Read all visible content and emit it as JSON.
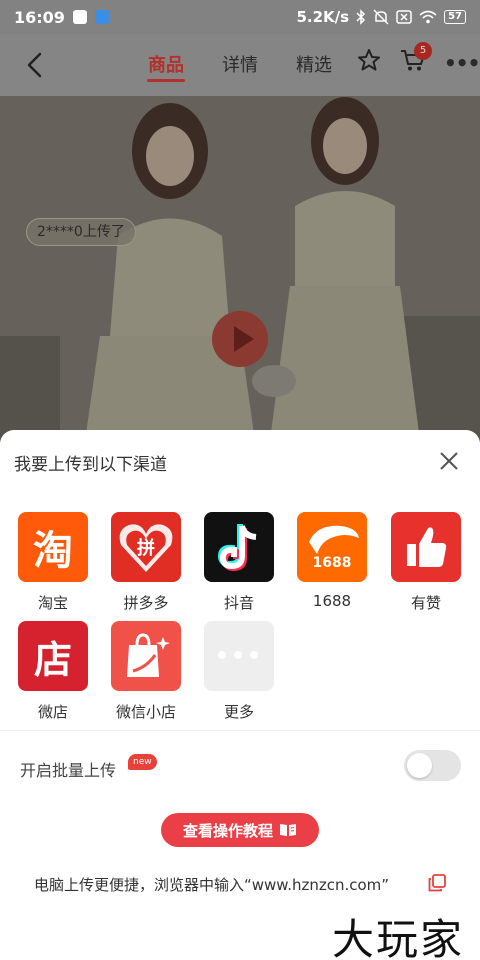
{
  "status_bar": {
    "time": "16:09",
    "network_speed": "5.2K/s",
    "battery": "57",
    "icons": [
      "bluetooth-icon",
      "mute-icon",
      "sim-off-icon",
      "wifi-icon",
      "battery-icon"
    ]
  },
  "navbar": {
    "tabs": [
      {
        "label": "商品",
        "active": true
      },
      {
        "label": "详情",
        "active": false
      },
      {
        "label": "精选",
        "active": false
      }
    ],
    "cart_count": "5",
    "more_label": "•••",
    "accent_color": "#b3312b"
  },
  "hero": {
    "upload_tag": "2****0上传了"
  },
  "sheet": {
    "title": "我要上传到以下渠道",
    "channels": [
      {
        "label": "淘宝",
        "glyph": "淘"
      },
      {
        "label": "拼多多",
        "glyph": "拼"
      },
      {
        "label": "抖音",
        "glyph": "♪"
      },
      {
        "label": "1688",
        "glyph": "1688"
      },
      {
        "label": "有赞",
        "glyph": "👍"
      },
      {
        "label": "微店",
        "glyph": "店"
      },
      {
        "label": "微信小店",
        "glyph": "🛍"
      },
      {
        "label": "更多",
        "glyph": "•••"
      }
    ],
    "batch_label": "开启批量上传",
    "new_badge": "new",
    "batch_enabled": false,
    "tutorial_button": "查看操作教程",
    "pc_tip": "电脑上传更便捷，浏览器中输入“www.hznzcn.com”",
    "primary_color": "#ea3f46"
  },
  "watermark": "大玩家"
}
